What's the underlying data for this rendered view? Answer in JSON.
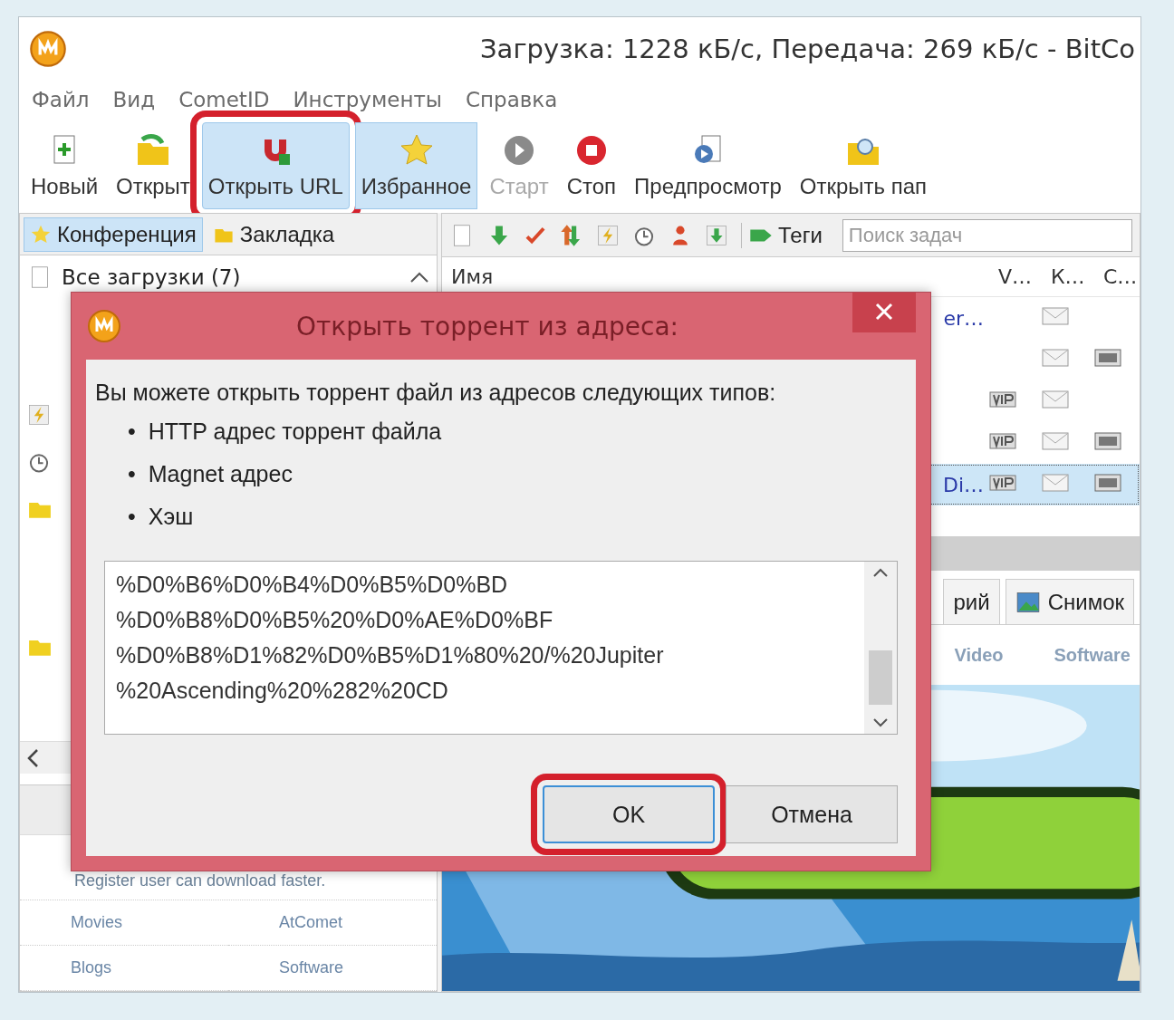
{
  "window": {
    "title": "Загрузка: 1228 кБ/с, Передача: 269 кБ/с - BitCo"
  },
  "menu": [
    "Файл",
    "Вид",
    "CometID",
    "Инструменты",
    "Справка"
  ],
  "toolbar": [
    {
      "label": "Новый",
      "selected": false,
      "disabled": false,
      "highlighted": false
    },
    {
      "label": "Открыт",
      "selected": false,
      "disabled": false,
      "highlighted": false
    },
    {
      "label": "Открыть URL",
      "selected": true,
      "disabled": false,
      "highlighted": true
    },
    {
      "label": "Избранное",
      "selected": true,
      "disabled": false,
      "highlighted": false
    },
    {
      "label": "Старт",
      "selected": false,
      "disabled": true,
      "highlighted": false
    },
    {
      "label": "Стоп",
      "selected": false,
      "disabled": false,
      "highlighted": false
    },
    {
      "label": "Предпросмотр",
      "selected": false,
      "disabled": false,
      "highlighted": false
    },
    {
      "label": "Открыть пап",
      "selected": false,
      "disabled": false,
      "highlighted": false
    }
  ],
  "sidebar": {
    "tabs": [
      {
        "label": "Конференция",
        "selected": true
      },
      {
        "label": "Закладка",
        "selected": false
      }
    ],
    "items": [
      "Все загрузки (7)"
    ],
    "notice": "Register user can download faster.",
    "links": [
      "Movies",
      "AtComet",
      "Blogs",
      "Software"
    ]
  },
  "task_toolbar": {
    "tags_label": "Теги",
    "search": {
      "placeholder": "Поиск задач"
    }
  },
  "table": {
    "columns": [
      "Имя",
      "V…",
      "К…",
      "С…"
    ],
    "rows": [
      {
        "name": "er…",
        "vip": false,
        "k": true,
        "c": false,
        "selected": false
      },
      {
        "name": "",
        "vip": false,
        "k": true,
        "c": true,
        "selected": false
      },
      {
        "name": "",
        "vip": true,
        "k": true,
        "c": false,
        "selected": false
      },
      {
        "name": "",
        "vip": true,
        "k": true,
        "c": true,
        "selected": false
      },
      {
        "name": "Di…",
        "vip": true,
        "k": true,
        "c": true,
        "selected": true
      }
    ]
  },
  "detail_tabs": [
    {
      "label": "рий",
      "selected": false
    },
    {
      "label": "Снимок",
      "selected": false
    }
  ],
  "detail_links": [
    "Video",
    "Software"
  ],
  "dialog": {
    "title": "Открыть торрент из адреса:",
    "intro": "Вы можете открыть торрент файл из адресов следующих типов:",
    "bullets": [
      {
        "marker": "•",
        "text": "HTTP адрес торрент файла"
      },
      {
        "marker": "•",
        "text": "Magnet адрес"
      },
      {
        "marker": "•",
        "text": "Хэш"
      }
    ],
    "url_lines": [
      "%D0%B6%D0%B4%D0%B5%D0%BD",
      "%D0%B8%D0%B5%20%D0%AE%D0%BF",
      "%D0%B8%D1%82%D0%B5%D1%80%20/%20Jupiter",
      "%20Ascending%20%282%20CD"
    ],
    "buttons": [
      {
        "label": "OK",
        "default": true,
        "highlighted": true
      },
      {
        "label": "Отмена",
        "default": false,
        "highlighted": false
      }
    ]
  }
}
